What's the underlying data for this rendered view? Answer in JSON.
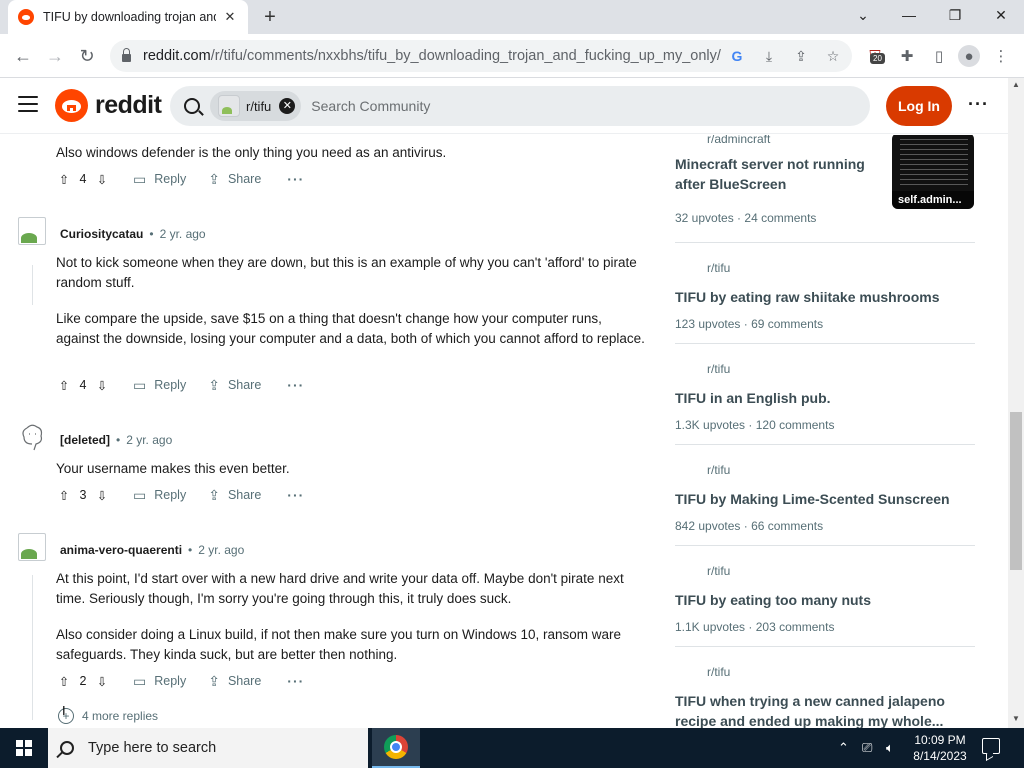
{
  "browser": {
    "tab_title": "TIFU by downloading trojan and",
    "url_domain": "reddit.com",
    "url_path": "/r/tifu/comments/nxxbhs/tifu_by_downloading_trojan_and_fucking_up_my_only/",
    "extension_badge": "20"
  },
  "header": {
    "logo_text": "reddit",
    "community_chip": "r/tifu",
    "search_placeholder": "Search Community",
    "login_label": "Log In"
  },
  "comments": [
    {
      "text": "Also windows defender is the only thing you need as an antivirus.",
      "votes": "4",
      "reply_label": "Reply",
      "share_label": "Share"
    },
    {
      "author": "Curiositycatau",
      "time": "2 yr. ago",
      "paragraphs": [
        "Not to kick someone when they are down, but this is an example of why you can't 'afford' to pirate random stuff.",
        "Like compare the upside, save $15 on a thing that doesn't change how your computer runs, against the downside, losing your computer and a data, both of which you cannot afford to replace."
      ],
      "votes": "4",
      "reply_label": "Reply",
      "share_label": "Share"
    },
    {
      "author": "[deleted]",
      "time": "2 yr. ago",
      "paragraphs": [
        "Your username makes this even better."
      ],
      "votes": "3",
      "reply_label": "Reply",
      "share_label": "Share"
    },
    {
      "author": "anima-vero-quaerenti",
      "time": "2 yr. ago",
      "paragraphs": [
        "At this point, I'd start over with a new hard drive and write your data off. Maybe don't pirate next time. Seriously though, I'm sorry you're going through this, it truly does suck.",
        "Also consider doing a Linux build, if not then make sure you turn on Windows 10, ransom ware safeguards. They kinda suck, but are better then nothing."
      ],
      "votes": "2",
      "reply_label": "Reply",
      "share_label": "Share"
    }
  ],
  "more_replies": "4 more replies",
  "sidebar": [
    {
      "sub": "r/admincraft",
      "title": "Minecraft server not running after BlueScreen",
      "upvotes": "32 upvotes",
      "comments": "24 comments",
      "thumb_label": "self.admin..."
    },
    {
      "sub": "r/tifu",
      "title": "TIFU by eating raw shiitake mushrooms",
      "upvotes": "123 upvotes",
      "comments": "69 comments"
    },
    {
      "sub": "r/tifu",
      "title": "TIFU in an English pub.",
      "upvotes": "1.3K upvotes",
      "comments": "120 comments"
    },
    {
      "sub": "r/tifu",
      "title": "TIFU by Making Lime-Scented Sunscreen",
      "upvotes": "842 upvotes",
      "comments": "66 comments"
    },
    {
      "sub": "r/tifu",
      "title": "TIFU by eating too many nuts",
      "upvotes": "1.1K upvotes",
      "comments": "203 comments"
    },
    {
      "sub": "r/tifu",
      "title": "TIFU when trying a new canned jalapeno recipe and ended up making my whole..."
    }
  ],
  "taskbar": {
    "search_placeholder": "Type here to search",
    "time": "10:09 PM",
    "date": "8/14/2023"
  },
  "colors": {
    "reddit_orange": "#ff4500",
    "login_button": "#d93a00",
    "taskbar": "#0c1c2c"
  }
}
